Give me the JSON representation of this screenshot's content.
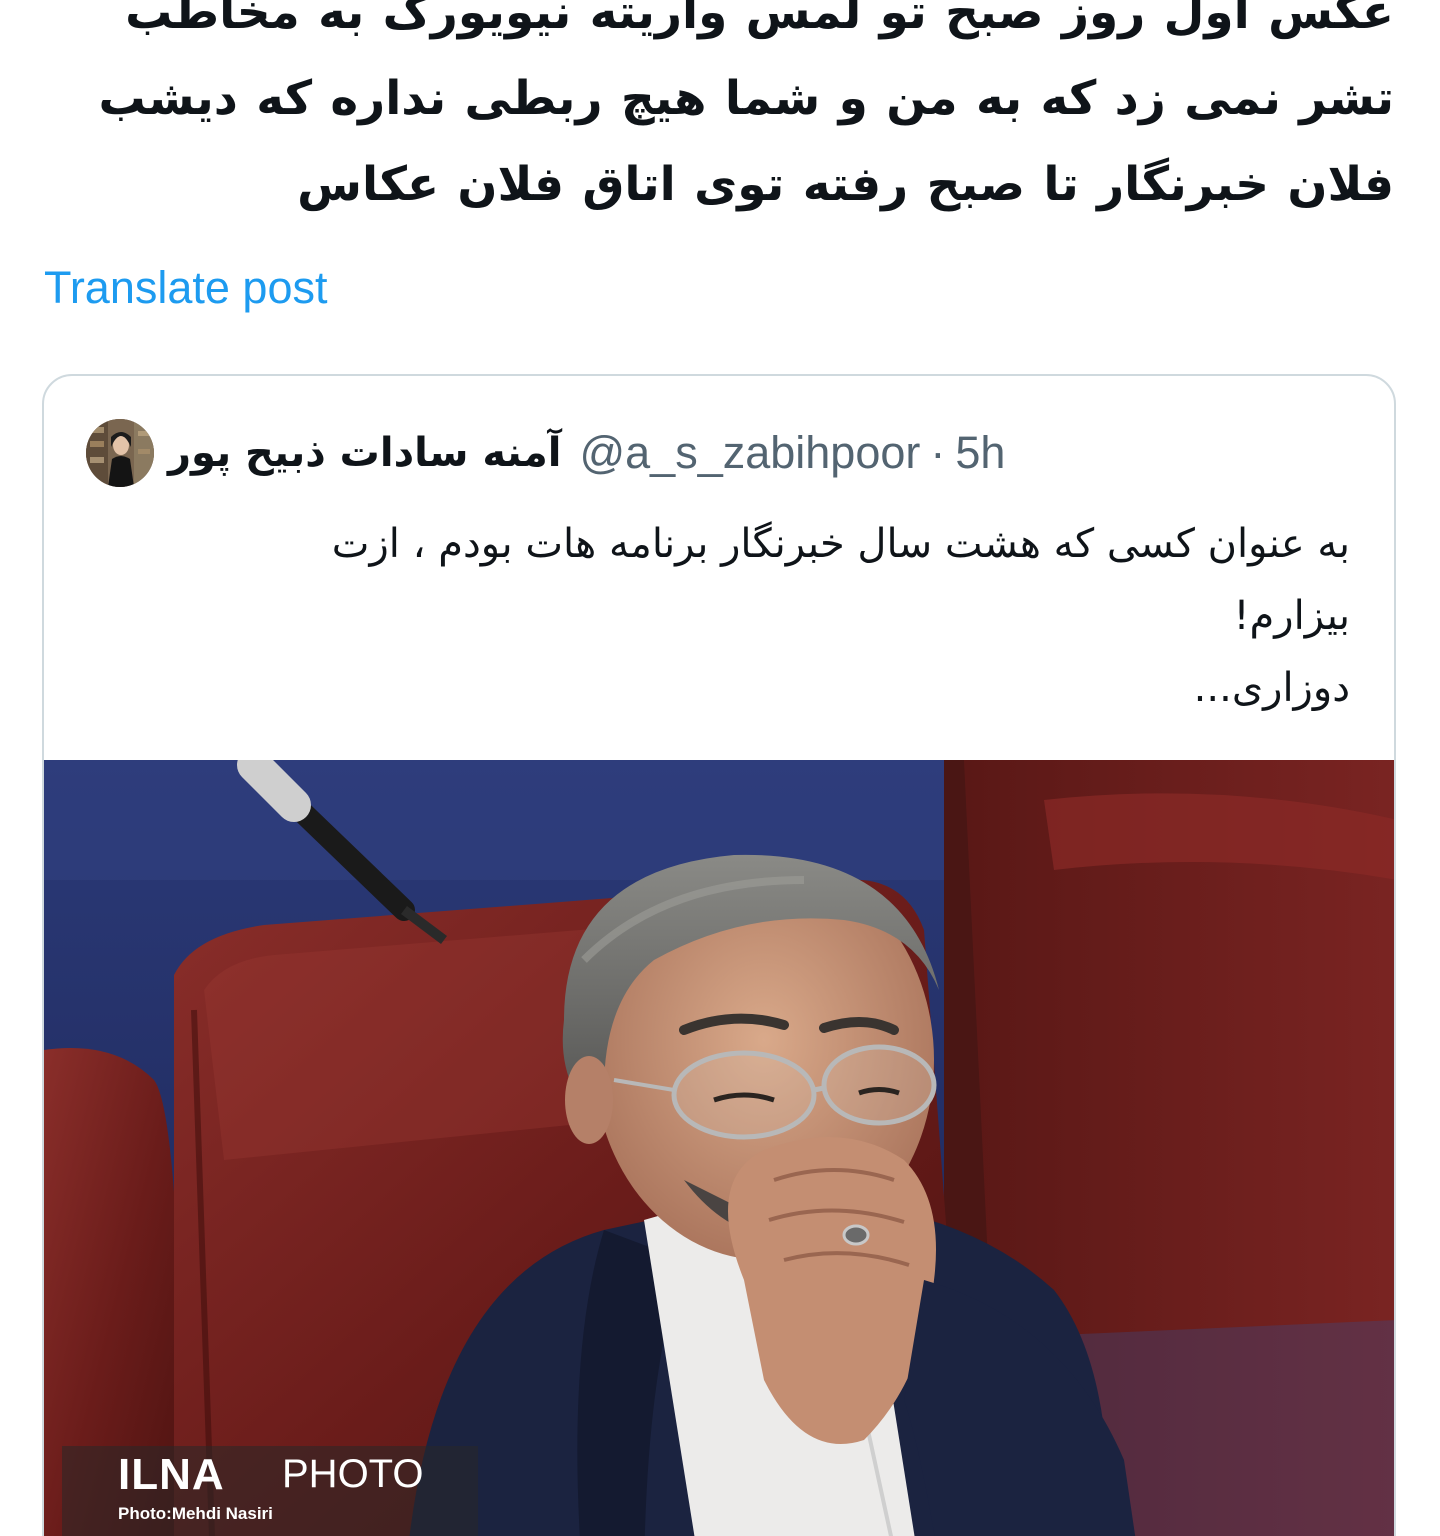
{
  "tweet": {
    "text_lines": [
      "عکس اول روز صبح تو لمس واریته نیویورک به مخاطب",
      "تشر نمی زد که به من و شما هیچ ربطی نداره که دیشب",
      "فلان خبرنگار تا صبح رفته توی اتاق فلان عکاس"
    ],
    "translate_label": "Translate post"
  },
  "quoted_tweet": {
    "author_name": "آمنه سادات ذبیح پور",
    "handle": "@a_s_zabihpoor",
    "separator": "·",
    "time": "5h",
    "body_lines": [
      "به عنوان کسی که هشت سال خبرنگار برنامه هات بودم ، ازت",
      "بیزارم!",
      "دوزاری..."
    ],
    "media": {
      "watermark_brand": "ILNA",
      "watermark_label": "PHOTO",
      "photo_credit": "Photo:Mehdi Nasiri"
    }
  },
  "colors": {
    "link": "#1d9bf0",
    "text": "#0f1419",
    "secondary": "#536471",
    "border": "#cfd9de"
  }
}
